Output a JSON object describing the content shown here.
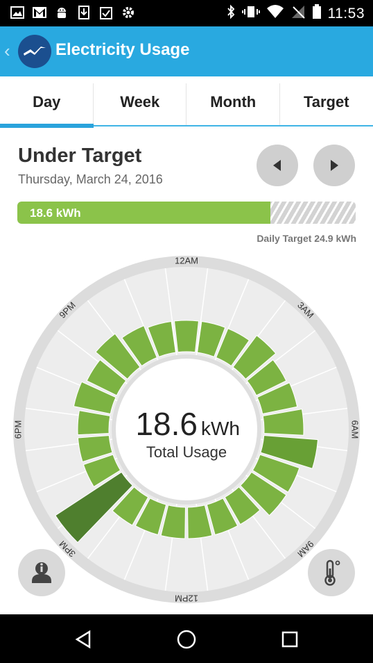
{
  "status_bar": {
    "time": "11:53"
  },
  "app_bar": {
    "title": "Electricity Usage"
  },
  "tabs": [
    {
      "label": "Day",
      "active": true
    },
    {
      "label": "Week",
      "active": false
    },
    {
      "label": "Month",
      "active": false
    },
    {
      "label": "Target",
      "active": false
    }
  ],
  "summary": {
    "status": "Under Target",
    "date": "Thursday, March 24, 2016",
    "usage_label": "18.6 kWh",
    "usage_value": 18.6,
    "target_label": "Daily Target 24.9 kWh",
    "target_value": 24.9
  },
  "dial": {
    "total_value": "18.6",
    "total_unit": "kWh",
    "total_label": "Total Usage",
    "hour_labels": [
      "12AM",
      "3AM",
      "6AM",
      "9AM",
      "12PM",
      "3PM",
      "6PM",
      "9PM"
    ],
    "hourly_usage_level": [
      0.3,
      0.3,
      0.3,
      0.38,
      0.32,
      0.34,
      0.38,
      0.52,
      0.4,
      0.4,
      0.3,
      0.3,
      0.3,
      0.3,
      0.3,
      0.31,
      0.76,
      0.3,
      0.3,
      0.3,
      0.36,
      0.32,
      0.4,
      0.33,
      0.3
    ],
    "colors": {
      "light": "#7cb342",
      "mid": "#68a035",
      "dark": "#4f7f2e",
      "sector": "#ededed",
      "ring": "#dcdcdc"
    }
  },
  "buttons": {
    "info_icon": "info-user-icon",
    "thermostat_icon": "thermometer-icon"
  },
  "colors": {
    "app_bar": "#29a9e0",
    "accent": "#2aa3dc",
    "progress": "#8bc34a"
  }
}
